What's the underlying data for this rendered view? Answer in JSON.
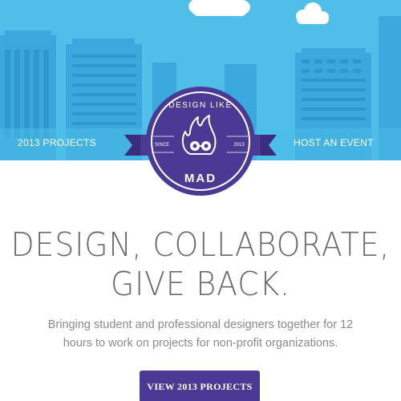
{
  "nav": {
    "left_link": "2013 PROJECTS",
    "right_link": "HOST AN EVENT"
  },
  "badge": {
    "top_text": "DESIGN LIKE",
    "bottom_text": "MAD",
    "since_label": "SINCE",
    "year": "2013",
    "icon": "flame-mascot-icon"
  },
  "hero": {
    "headline_line1": "DESIGN, COLLABORATE,",
    "headline_line2": "GIVE BACK.",
    "tagline_line1": "Bringing student and professional designers together for 12",
    "tagline_line2": "hours to work on projects for non-profit organizations.",
    "cta_label": "VIEW 2013 PROJECTS"
  },
  "colors": {
    "sky": "#4fbfea",
    "building": "#3aa8dc",
    "badge_purple": "#4a3a93",
    "text_gray": "#6a6a6a"
  }
}
